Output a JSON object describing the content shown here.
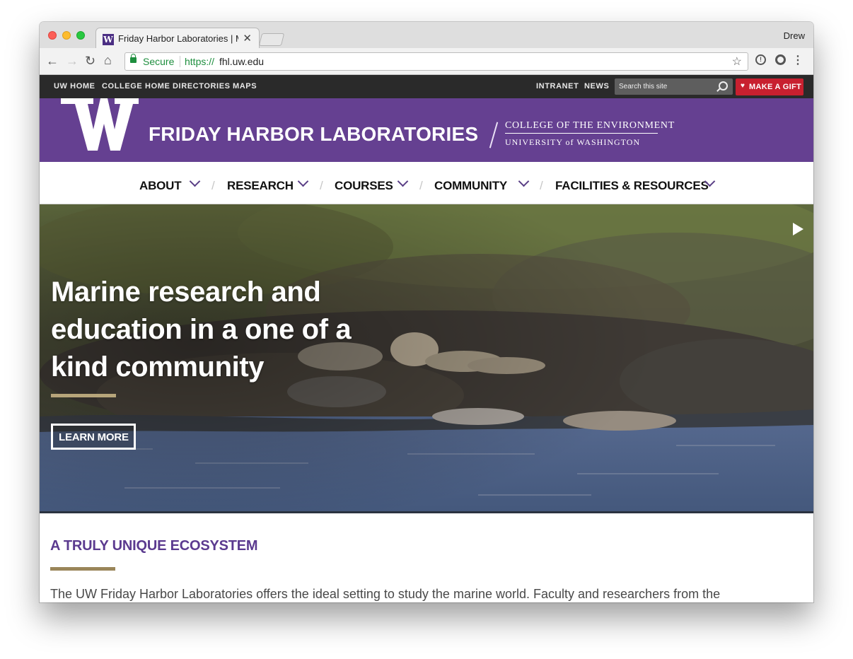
{
  "browser": {
    "tab_title": "Friday Harbor Laboratories | M",
    "favicon_letter": "W",
    "tab_close": "✕",
    "profile_name": "Drew",
    "security_label": "Secure",
    "url_scheme": "https://",
    "url_host": "fhl.uw.edu",
    "icons": [
      "back-icon",
      "forward-icon",
      "reload-icon",
      "home-icon",
      "lock-icon",
      "star-icon",
      "extension-icon",
      "menu-icon"
    ]
  },
  "utility_nav": {
    "left_links": [
      "UW HOME",
      "COLLEGE HOME",
      "DIRECTORIES",
      "MAPS"
    ],
    "right_links": [
      "INTRANET",
      "NEWS"
    ],
    "search_placeholder": "Search this site",
    "gift_label": "MAKE A GIFT"
  },
  "brand": {
    "site_title": "FRIDAY HARBOR LABORATORIES",
    "college_line": "COLLEGE OF THE ENVIRONMENT",
    "university_line": "UNIVERSITY of WASHINGTON"
  },
  "main_nav": {
    "items": [
      "ABOUT",
      "RESEARCH",
      "COURSES",
      "COMMUNITY",
      "FACILITIES & RESOURCES"
    ]
  },
  "hero": {
    "line1": "Marine research and",
    "line2": "education in a one of a",
    "line3": "kind community",
    "button_label": "LEARN MORE"
  },
  "intro": {
    "title": "A TRULY UNIQUE ECOSYSTEM",
    "text": "The UW Friday Harbor Laboratories offers the ideal setting to study the marine world. Faculty and researchers from the"
  },
  "colors": {
    "uw_purple": "#4b2e83",
    "brand_bar": "#654091",
    "gold": "#b7a57a",
    "gift_red": "#c8202f",
    "utility_bar": "#2a2a2a"
  }
}
